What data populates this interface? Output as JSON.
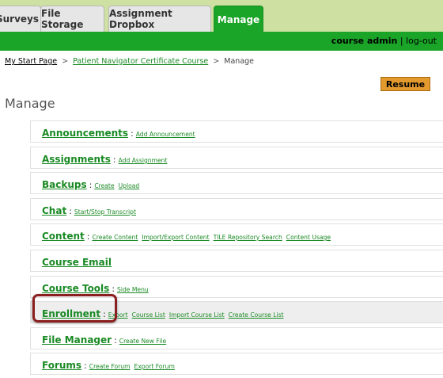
{
  "tabs": [
    {
      "label": "Surveys",
      "active": false
    },
    {
      "label": "File Storage",
      "active": false
    },
    {
      "label": "Assignment Dropbox",
      "active": false
    },
    {
      "label": "Manage",
      "active": true
    }
  ],
  "user": {
    "name": "course admin",
    "separator": " | ",
    "logout": "log-out"
  },
  "breadcrumb": {
    "home": "My Start Page",
    "sep1": ">",
    "course": "Patient Navigator Certificate Course",
    "sep2": ">",
    "current": "Manage"
  },
  "resume_label": "Resume",
  "page_title": "Manage",
  "rows": [
    {
      "title": "Announcements",
      "links": [
        "Add Announcement"
      ]
    },
    {
      "title": "Assignments",
      "links": [
        "Add Assignment"
      ]
    },
    {
      "title": "Backups",
      "links": [
        "Create",
        "Upload"
      ]
    },
    {
      "title": "Chat",
      "links": [
        "Start/Stop Transcript"
      ]
    },
    {
      "title": "Content",
      "links": [
        "Create Content",
        "Import/Export Content",
        "TILE Repository Search",
        "Content Usage"
      ]
    },
    {
      "title": "Course Email",
      "links": []
    },
    {
      "title": "Course Tools",
      "links": [
        "Side Menu"
      ]
    },
    {
      "title": "Enrollment",
      "links": [
        "Export",
        "Course List",
        "Import Course List",
        "Create Course List"
      ],
      "highlighted": true
    },
    {
      "title": "File Manager",
      "links": [
        "Create New File"
      ]
    },
    {
      "title": "Forums",
      "links": [
        "Create Forum",
        "Export Forum"
      ]
    }
  ],
  "colors": {
    "brand_green": "#1aa428",
    "link_green": "#1a8a24",
    "resume_orange": "#e29a2e",
    "callout_red": "#8b1f1f"
  }
}
